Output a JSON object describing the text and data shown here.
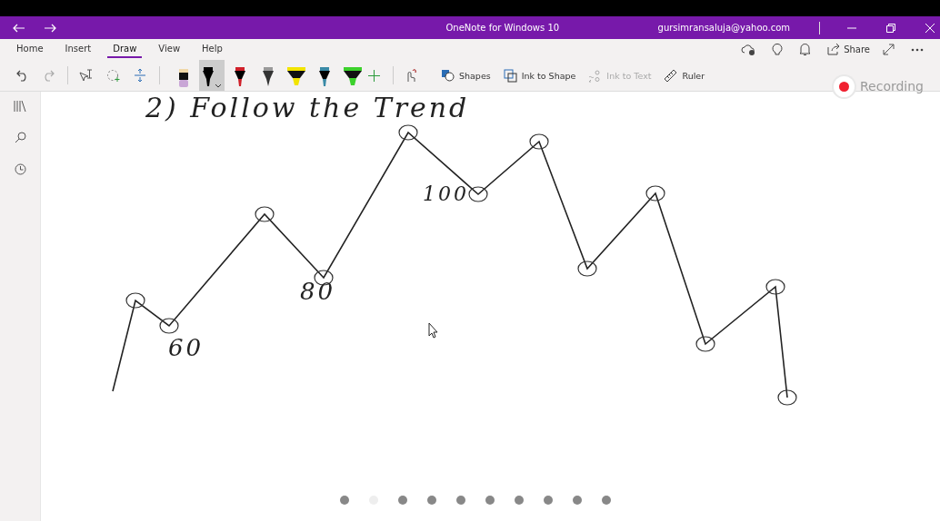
{
  "window": {
    "title": "OneNote for Windows 10",
    "account": "gursimransaluja@yahoo.com"
  },
  "tabs": [
    {
      "label": "Home",
      "selected": false
    },
    {
      "label": "Insert",
      "selected": false
    },
    {
      "label": "Draw",
      "selected": true
    },
    {
      "label": "View",
      "selected": false
    },
    {
      "label": "Help",
      "selected": false
    }
  ],
  "share": "Share",
  "pens": [
    {
      "kind": "eraser",
      "color": "#c9a6d6",
      "selected": false
    },
    {
      "kind": "pen",
      "color": "#000000",
      "selected": true
    },
    {
      "kind": "pen",
      "color": "#d0202a",
      "selected": false
    },
    {
      "kind": "pencil",
      "color": "#333333",
      "selected": false
    },
    {
      "kind": "highlighter",
      "color": "#f2e400",
      "selected": false
    },
    {
      "kind": "pen",
      "color": "#3a8aa6",
      "selected": false
    },
    {
      "kind": "highlighter",
      "color": "#3cd12c",
      "selected": false
    }
  ],
  "tools": [
    {
      "kind": "shapes",
      "label": "Shapes",
      "disabled": false
    },
    {
      "kind": "ink-shape",
      "label": "Ink to Shape",
      "disabled": false
    },
    {
      "kind": "ink-text",
      "label": "Ink to Text",
      "disabled": true
    },
    {
      "kind": "ruler",
      "label": "Ruler",
      "disabled": false
    }
  ],
  "recording": "Recording",
  "handwriting": [
    {
      "text": "2) Follow the Trend"
    },
    {
      "text": "100"
    },
    {
      "text": "80"
    },
    {
      "text": "60"
    }
  ],
  "page_dots": [
    {
      "selected": false
    },
    {
      "selected": true
    },
    {
      "selected": false
    },
    {
      "selected": false
    },
    {
      "selected": false
    },
    {
      "selected": false
    },
    {
      "selected": false
    },
    {
      "selected": false
    },
    {
      "selected": false
    },
    {
      "selected": false
    }
  ]
}
